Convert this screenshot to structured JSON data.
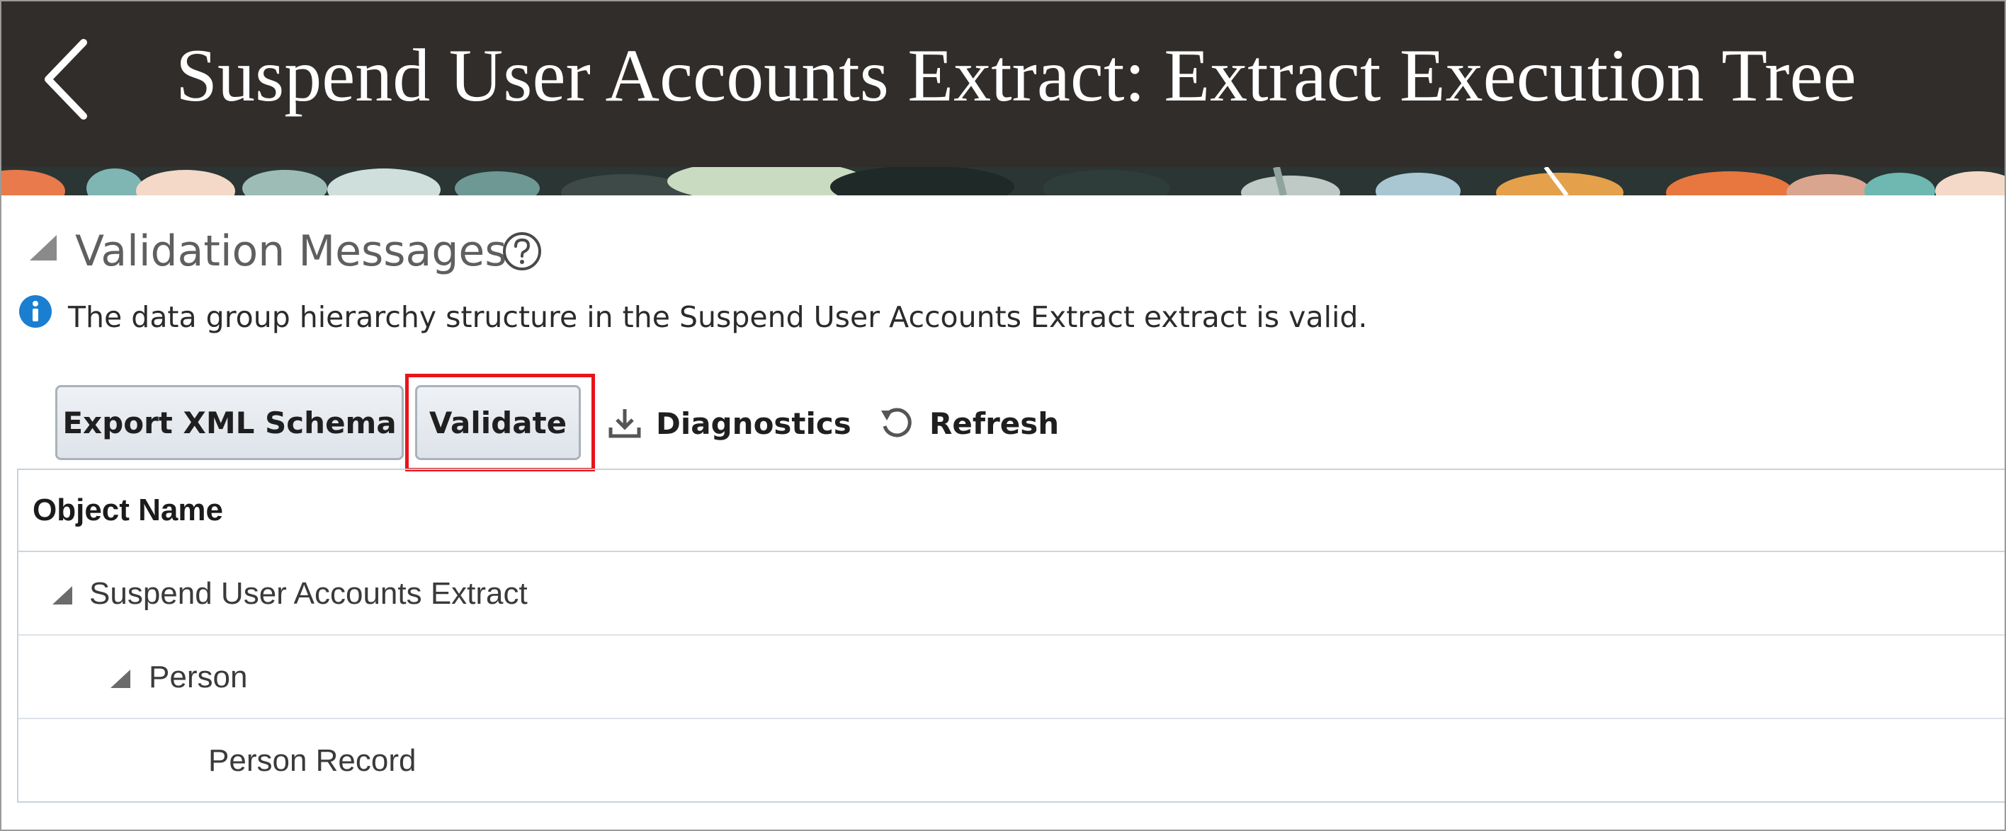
{
  "header": {
    "title": "Suspend User Accounts Extract: Extract Execution Tree",
    "back_icon": "chevron-left-icon"
  },
  "validation": {
    "title": "Validation Messages",
    "help_icon": "help-circle-icon",
    "info_icon": "info-icon",
    "message": "The data group hierarchy structure in the Suspend User Accounts Extract extract is valid."
  },
  "toolbar": {
    "export_label": "Export XML Schema",
    "validate_label": "Validate",
    "diagnostics_label": "Diagnostics",
    "refresh_label": "Refresh",
    "highlight_color": "#e8141a"
  },
  "table": {
    "columns": [
      "Object Name"
    ],
    "rows": [
      {
        "label": "Suspend User Accounts Extract",
        "level": 0,
        "expanded": true
      },
      {
        "label": "Person",
        "level": 1,
        "expanded": true
      },
      {
        "label": "Person Record",
        "level": 2,
        "expanded": false
      }
    ]
  },
  "colors": {
    "header_bg": "#312d2a",
    "info_blue": "#1a7fd0",
    "accent_red": "#e8141a"
  }
}
